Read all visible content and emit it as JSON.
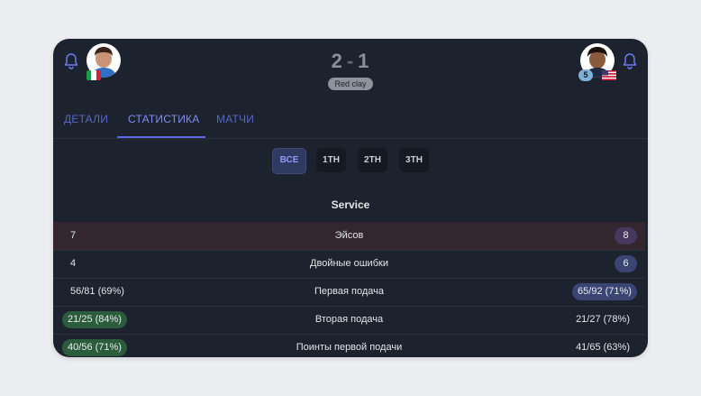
{
  "match": {
    "score_home": "2",
    "score_sep": "-",
    "score_away": "1",
    "surface": "Red clay"
  },
  "players": {
    "home": {
      "flag": "IT"
    },
    "away": {
      "flag": "US",
      "seed": "5"
    }
  },
  "tabs": [
    {
      "label": "ДЕТАЛИ",
      "active": false
    },
    {
      "label": "СТАТИСТИКА",
      "active": true
    },
    {
      "label": "МАТЧИ",
      "active": false
    }
  ],
  "periods": [
    {
      "label": "ВСЕ",
      "active": true
    },
    {
      "label": "1TH",
      "active": false
    },
    {
      "label": "2TH",
      "active": false
    },
    {
      "label": "3TH",
      "active": false
    }
  ],
  "section": {
    "title": "Service"
  },
  "stats": [
    {
      "name": "Эйсов",
      "home": "7",
      "away": "8",
      "highlight": "away"
    },
    {
      "name": "Двойные ошибки",
      "home": "4",
      "away": "6",
      "highlight": "away"
    },
    {
      "name": "Первая подача",
      "home": "56/81 (69%)",
      "away": "65/92 (71%)",
      "highlight": "away"
    },
    {
      "name": "Вторая подача",
      "home": "21/25 (84%)",
      "away": "21/27 (78%)",
      "highlight": "home"
    },
    {
      "name": "Поинты первой подачи",
      "home": "40/56 (71%)",
      "away": "41/65 (63%)",
      "highlight": "home"
    }
  ],
  "colors": {
    "card_bg": "#1c232e",
    "accent": "#5a6ae6",
    "win_green": "#2b5c3b",
    "win_blue": "#3a4574",
    "win_purple": "#47385e"
  }
}
